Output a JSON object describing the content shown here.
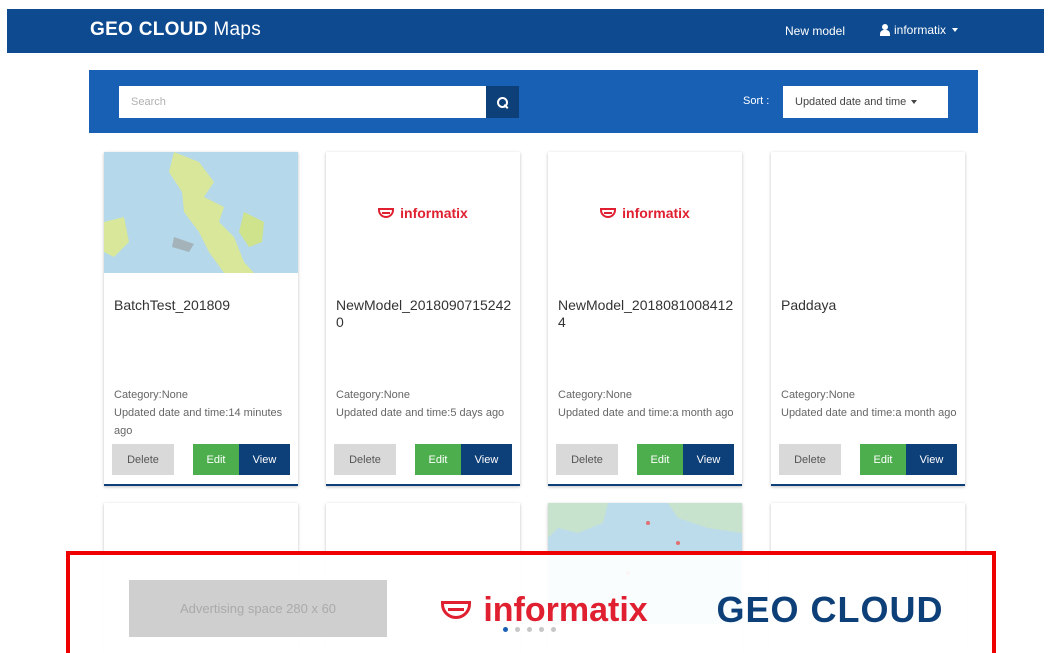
{
  "navbar": {
    "brand_geo": "GEO CLOUD",
    "brand_maps": "Maps",
    "new_model": "New model",
    "user": "informatix"
  },
  "search": {
    "placeholder": "Search",
    "sort_label": "Sort :",
    "sort_value": "Updated date and time"
  },
  "buttons": {
    "delete": "Delete",
    "edit": "Edit",
    "view": "View"
  },
  "thumb_logo_text": "informatix",
  "cards": [
    {
      "title": "BatchTest_201809",
      "category": "Category:None",
      "updated": "Updated date and time:14 minutes ago"
    },
    {
      "title": "NewModel_20180907152420",
      "category": "Category:None",
      "updated": "Updated date and time:5 days ago"
    },
    {
      "title": "NewModel_20180810084124",
      "category": "Category:None",
      "updated": "Updated date and time:a month ago"
    },
    {
      "title": "Paddaya",
      "category": "Category:None",
      "updated": "Updated date and time:a month ago"
    }
  ],
  "ad": {
    "placeholder": "Advertising space 280 x 60",
    "informatix": "informatix",
    "geocloud": "GEO CLOUD",
    "dots_total": 5,
    "dots_active": 1
  },
  "colors": {
    "navbar": "#0d4a8f",
    "search_panel": "#1860b4",
    "view_button": "#0d3f78",
    "edit_button": "#4cae4c",
    "delete_button": "#d9d9d9",
    "informatix_red": "#e02030",
    "ad_frame": "#ee0000"
  }
}
